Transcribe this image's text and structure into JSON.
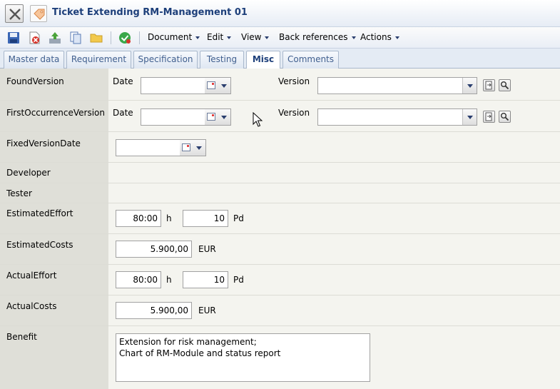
{
  "window": {
    "title": "Ticket Extending RM-Management 01"
  },
  "icons": {
    "close": "close-x-icon",
    "tag": "tag-icon",
    "save": "save-icon",
    "delete": "delete-icon",
    "upload": "upload-icon",
    "copy": "copy-icon",
    "folder": "folder-icon",
    "check": "check-icon"
  },
  "menus": [
    "Document",
    "Edit",
    "View",
    "Back references",
    "Actions"
  ],
  "tabs": [
    {
      "label": "Master data"
    },
    {
      "label": "Requirement"
    },
    {
      "label": "Specification"
    },
    {
      "label": "Testing"
    },
    {
      "label": "Misc"
    },
    {
      "label": "Comments"
    }
  ],
  "active_tab": "Misc",
  "fields": {
    "found_version": {
      "label": "FoundVersion",
      "date_label": "Date",
      "date_value": "",
      "version_label": "Version",
      "version_value": ""
    },
    "first_occurrence_version": {
      "label": "FirstOccurrenceVersion",
      "date_label": "Date",
      "date_value": "",
      "version_label": "Version",
      "version_value": ""
    },
    "fixed_version_date": {
      "label": "FixedVersionDate",
      "date_value": ""
    },
    "developer": {
      "label": "Developer"
    },
    "tester": {
      "label": "Tester"
    },
    "estimated_effort": {
      "label": "EstimatedEffort",
      "hours": "80:00",
      "hours_unit": "h",
      "days": "10",
      "days_unit": "Pd"
    },
    "estimated_costs": {
      "label": "EstimatedCosts",
      "value": "5.900,00",
      "unit": "EUR"
    },
    "actual_effort": {
      "label": "ActualEffort",
      "hours": "80:00",
      "hours_unit": "h",
      "days": "10",
      "days_unit": "Pd"
    },
    "actual_costs": {
      "label": "ActualCosts",
      "value": "5.900,00",
      "unit": "EUR"
    },
    "benefit": {
      "label": "Benefit",
      "line1": "Extension for risk management;",
      "line2": "Chart of RM-Module and status report"
    }
  }
}
